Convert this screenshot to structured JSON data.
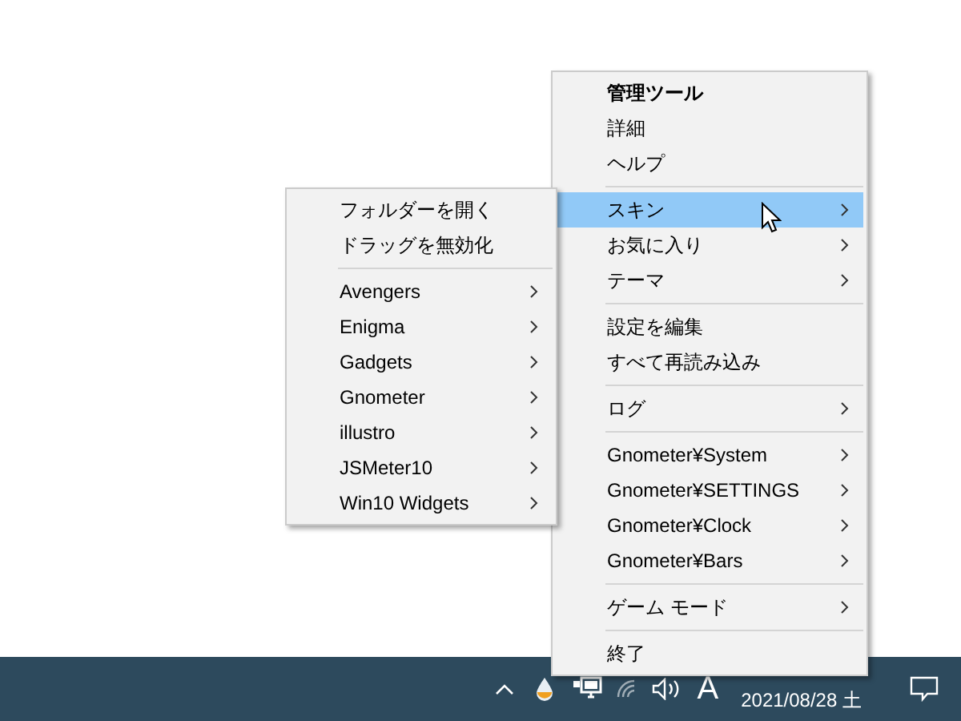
{
  "main_menu": {
    "items": [
      {
        "kind": "item",
        "label": "管理ツール",
        "bold": true,
        "submenu": false,
        "selected": false
      },
      {
        "kind": "item",
        "label": "詳細",
        "bold": false,
        "submenu": false,
        "selected": false
      },
      {
        "kind": "item",
        "label": "ヘルプ",
        "bold": false,
        "submenu": false,
        "selected": false
      },
      {
        "kind": "separator"
      },
      {
        "kind": "item",
        "label": "スキン",
        "bold": false,
        "submenu": true,
        "selected": true
      },
      {
        "kind": "item",
        "label": "お気に入り",
        "bold": false,
        "submenu": true,
        "selected": false
      },
      {
        "kind": "item",
        "label": "テーマ",
        "bold": false,
        "submenu": true,
        "selected": false
      },
      {
        "kind": "separator"
      },
      {
        "kind": "item",
        "label": "設定を編集",
        "bold": false,
        "submenu": false,
        "selected": false
      },
      {
        "kind": "item",
        "label": "すべて再読み込み",
        "bold": false,
        "submenu": false,
        "selected": false
      },
      {
        "kind": "separator"
      },
      {
        "kind": "item",
        "label": "ログ",
        "bold": false,
        "submenu": true,
        "selected": false
      },
      {
        "kind": "separator"
      },
      {
        "kind": "item",
        "label": "Gnometer¥System",
        "bold": false,
        "submenu": true,
        "selected": false
      },
      {
        "kind": "item",
        "label": "Gnometer¥SETTINGS",
        "bold": false,
        "submenu": true,
        "selected": false
      },
      {
        "kind": "item",
        "label": "Gnometer¥Clock",
        "bold": false,
        "submenu": true,
        "selected": false
      },
      {
        "kind": "item",
        "label": "Gnometer¥Bars",
        "bold": false,
        "submenu": true,
        "selected": false
      },
      {
        "kind": "separator"
      },
      {
        "kind": "item",
        "label": "ゲーム モード",
        "bold": false,
        "submenu": true,
        "selected": false
      },
      {
        "kind": "separator"
      },
      {
        "kind": "item",
        "label": "終了",
        "bold": false,
        "submenu": false,
        "selected": false
      }
    ]
  },
  "skin_submenu": {
    "items": [
      {
        "kind": "item",
        "label": "フォルダーを開く",
        "bold": false,
        "submenu": false,
        "selected": false
      },
      {
        "kind": "item",
        "label": "ドラッグを無効化",
        "bold": false,
        "submenu": false,
        "selected": false
      },
      {
        "kind": "separator"
      },
      {
        "kind": "item",
        "label": "Avengers",
        "bold": false,
        "submenu": true,
        "selected": false
      },
      {
        "kind": "item",
        "label": "Enigma",
        "bold": false,
        "submenu": true,
        "selected": false
      },
      {
        "kind": "item",
        "label": "Gadgets",
        "bold": false,
        "submenu": true,
        "selected": false
      },
      {
        "kind": "item",
        "label": "Gnometer",
        "bold": false,
        "submenu": true,
        "selected": false
      },
      {
        "kind": "item",
        "label": "illustro",
        "bold": false,
        "submenu": true,
        "selected": false
      },
      {
        "kind": "item",
        "label": "JSMeter10",
        "bold": false,
        "submenu": true,
        "selected": false
      },
      {
        "kind": "item",
        "label": "Win10 Widgets",
        "bold": false,
        "submenu": true,
        "selected": false
      }
    ]
  },
  "taskbar": {
    "input_indicator": "A",
    "date": "2021/08/28 土"
  }
}
